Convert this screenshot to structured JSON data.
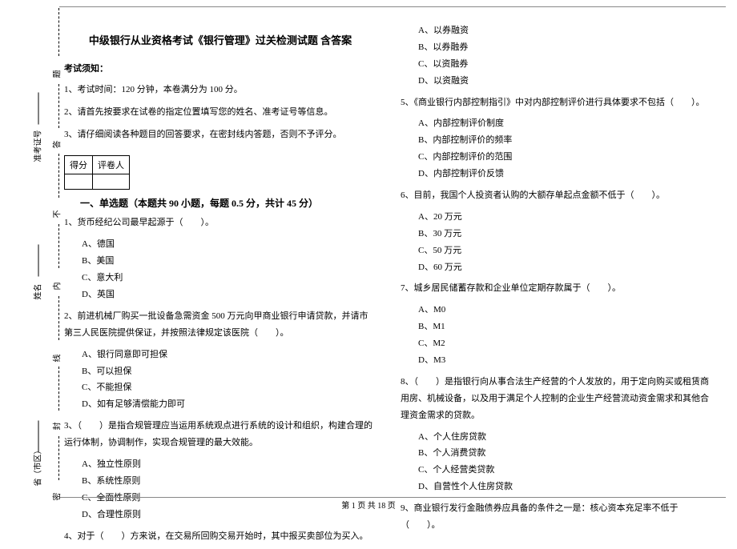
{
  "side": {
    "region": "省（市区）",
    "seal1": "密",
    "seal2": "封",
    "seal3": "线",
    "seal4": "内",
    "seal5": "不",
    "seal6": "答",
    "seal7": "题",
    "name": "姓名",
    "ticket": "准考证号"
  },
  "title": "中级银行从业资格考试《银行管理》过关检测试题 含答案",
  "notice_head": "考试须知：",
  "notice": {
    "n1": "1、考试时间：120 分钟，本卷满分为 100 分。",
    "n2": "2、请首先按要求在试卷的指定位置填写您的姓名、准考证号等信息。",
    "n3": "3、请仔细阅读各种题目的回答要求，在密封线内答题，否则不予评分。"
  },
  "score_labels": {
    "a": "得分",
    "b": "评卷人"
  },
  "section1": "一、单选题（本题共 90 小题，每题 0.5 分，共计 45 分）",
  "q1": {
    "text": "1、货币经纪公司最早起源于（　　）。",
    "a": "A、德国",
    "b": "B、美国",
    "c": "C、意大利",
    "d": "D、英国"
  },
  "q2": {
    "text": "2、前进机械厂购买一批设备急需资金 500 万元向甲商业银行申请贷款，并请市第三人民医院提供保证，并按照法律规定该医院（　　）。",
    "a": "A、银行同意即可担保",
    "b": "B、可以担保",
    "c": "C、不能担保",
    "d": "D、如有足够清偿能力即可"
  },
  "q3": {
    "text": "3、（　　）是指合规管理应当运用系统观点进行系统的设计和组织，构建合理的运行体制，协调制作，实现合规管理的最大效能。",
    "a": "A、独立性原则",
    "b": "B、系统性原则",
    "c": "C、全面性原则",
    "d": "D、合理性原则"
  },
  "q4": {
    "text": "4、对于（　　）方来说，在交易所回购交易开始时，其中报买卖部位为买入。"
  },
  "q4opts": {
    "a": "A、以券融资",
    "b": "B、以券融券",
    "c": "C、以资融券",
    "d": "D、以资融资"
  },
  "q5": {
    "text": "5、《商业银行内部控制指引》中对内部控制评价进行具体要求不包括（　　）。",
    "a": "A、内部控制评价制度",
    "b": "B、内部控制评价的频率",
    "c": "C、内部控制评价的范围",
    "d": "D、内部控制评价反馈"
  },
  "q6": {
    "text": "6、目前，我国个人投资者认购的大额存单起点金额不低于（　　）。",
    "a": "A、20 万元",
    "b": "B、30 万元",
    "c": "C、50 万元",
    "d": "D、60 万元"
  },
  "q7": {
    "text": "7、城乡居民储蓄存款和企业单位定期存款属于（　　）。",
    "a": "A、M0",
    "b": "B、M1",
    "c": "C、M2",
    "d": "D、M3"
  },
  "q8": {
    "text": "8、（　　）是指银行向从事合法生产经营的个人发放的，用于定向购买或租赁商用房、机械设备，以及用于满足个人控制的企业生产经营流动资金需求和其他合理资金需求的贷款。",
    "a": "A、个人住房贷款",
    "b": "B、个人消费贷款",
    "c": "C、个人经营类贷款",
    "d": "D、自营性个人住房贷款"
  },
  "q9": {
    "text": "9、商业银行发行金融债券应具备的条件之一是：核心资本充足率不低于（　　）。"
  },
  "footer": "第 1 页 共 18 页"
}
